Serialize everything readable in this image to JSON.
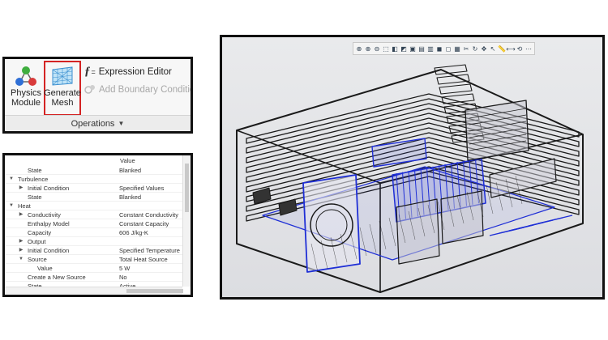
{
  "ribbon": {
    "physics_module": {
      "line1": "Physics",
      "line2": "Module",
      "icon": "atom-icon"
    },
    "generate_mesh": {
      "line1": "Generate",
      "line2": "Mesh",
      "icon": "mesh-grid-icon",
      "highlight": "#d42323"
    },
    "expression_editor": {
      "label": "Expression Editor",
      "icon": "fx-icon"
    },
    "add_boundary_condition": {
      "label": "Add Boundary Condition",
      "icon": "boundary-condition-icon",
      "enabled": false
    },
    "group_label": "Operations"
  },
  "properties": {
    "value_header": "Value",
    "rows": [
      {
        "indent": 1,
        "expander": "",
        "name": "State",
        "value": "Blanked"
      },
      {
        "indent": 0,
        "expander": "▼",
        "name": "Turbulence",
        "value": ""
      },
      {
        "indent": 1,
        "expander": "▶",
        "name": "Initial Condition",
        "value": "Specified Values"
      },
      {
        "indent": 1,
        "expander": "",
        "name": "State",
        "value": "Blanked"
      },
      {
        "indent": 0,
        "expander": "▼",
        "name": "Heat",
        "value": ""
      },
      {
        "indent": 1,
        "expander": "▶",
        "name": "Conductivity",
        "value": "Constant Conductivity"
      },
      {
        "indent": 1,
        "expander": "",
        "name": "Enthalpy Model",
        "value": "Constant Capacity"
      },
      {
        "indent": 1,
        "expander": "",
        "name": "Capacity",
        "value": "606 J/kg-K"
      },
      {
        "indent": 1,
        "expander": "▶",
        "name": "Output",
        "value": ""
      },
      {
        "indent": 1,
        "expander": "▶",
        "name": "Initial Condition",
        "value": "Specified Temperature"
      },
      {
        "indent": 1,
        "expander": "▼",
        "name": "Source",
        "value": "Total Heat Source"
      },
      {
        "indent": 2,
        "expander": "",
        "name": "Value",
        "value": "5 W"
      },
      {
        "indent": 1,
        "expander": "",
        "name": "Create a New Source",
        "value": "No"
      },
      {
        "indent": 1,
        "expander": "",
        "name": "State",
        "value": "Active"
      }
    ]
  },
  "viewport": {
    "toolbar_icons": [
      "zoom-fit-icon",
      "zoom-in-icon",
      "zoom-out-icon",
      "zoom-window-icon",
      "view-cube-icon",
      "iso-view-icon",
      "front-view-icon",
      "top-view-icon",
      "side-view-icon",
      "shaded-icon",
      "wireframe-icon",
      "hidden-line-icon",
      "section-icon",
      "rotate-icon",
      "pan-icon",
      "select-icon",
      "measure-icon",
      "ruler-icon",
      "reset-icon",
      "more-icon"
    ],
    "colors": {
      "wire": "#1a1a1a",
      "highlight": "#1f2fd6"
    }
  }
}
